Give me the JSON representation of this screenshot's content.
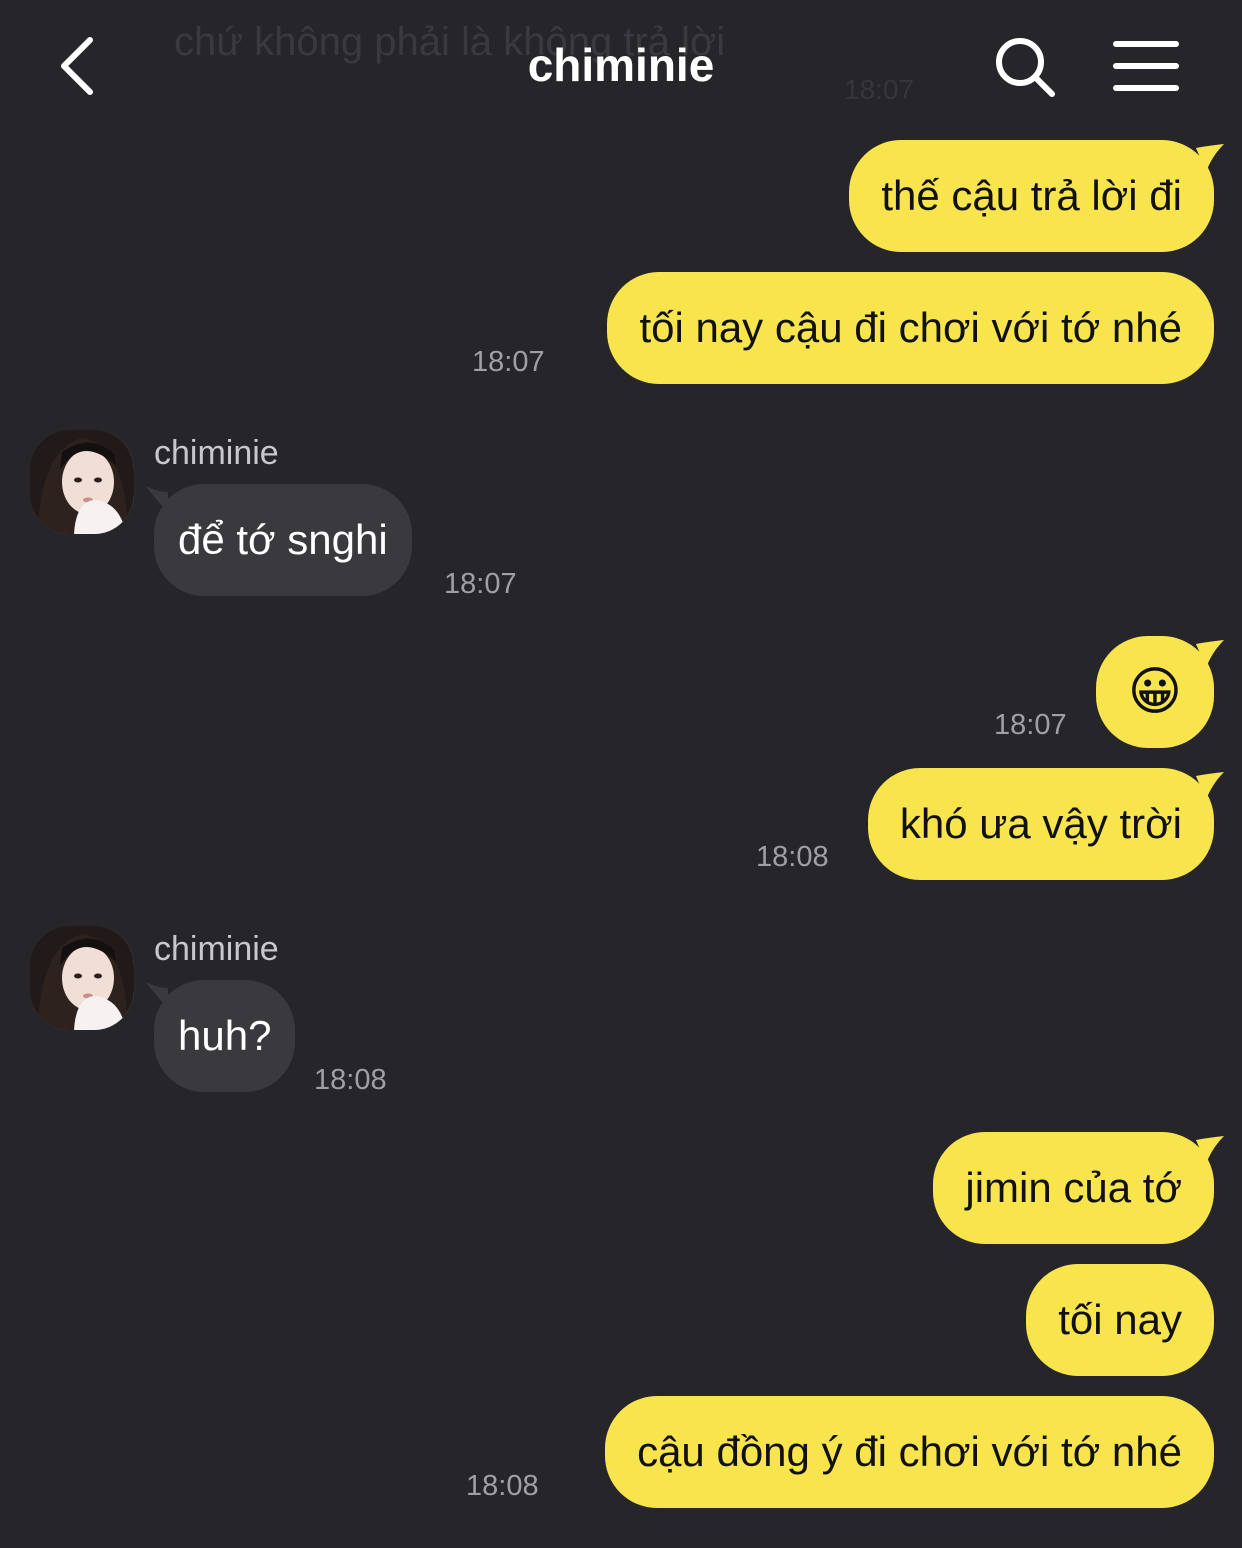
{
  "ghost": {
    "text": "chứ không phải là không trả lời",
    "time": "18:07"
  },
  "header": {
    "title": "chiminie",
    "back_icon": "chevron-left-icon",
    "search_icon": "search-icon",
    "menu_icon": "hamburger-menu-icon"
  },
  "colors": {
    "background": "#26262a",
    "outgoing": "#f8e44c",
    "incoming": "#3a3a3e"
  },
  "messages": [
    {
      "dir": "out",
      "text": "thế cậu trả lời đi",
      "time": ""
    },
    {
      "dir": "out",
      "text": "tối nay cậu đi chơi với tớ nhé",
      "time": "18:07"
    },
    {
      "dir": "in",
      "sender": "chiminie",
      "text": "để tớ snghi",
      "time": "18:07"
    },
    {
      "dir": "out",
      "text": "😀",
      "time": "18:07"
    },
    {
      "dir": "out",
      "text": "khó ưa vậy trời",
      "time": "18:08"
    },
    {
      "dir": "in",
      "sender": "chiminie",
      "text": "huh?",
      "time": "18:08"
    },
    {
      "dir": "out",
      "text": "jimin của tớ",
      "time": ""
    },
    {
      "dir": "out",
      "text": "tối nay",
      "time": ""
    },
    {
      "dir": "out",
      "text": "cậu đồng ý đi chơi với tớ nhé",
      "time": "18:08"
    }
  ]
}
